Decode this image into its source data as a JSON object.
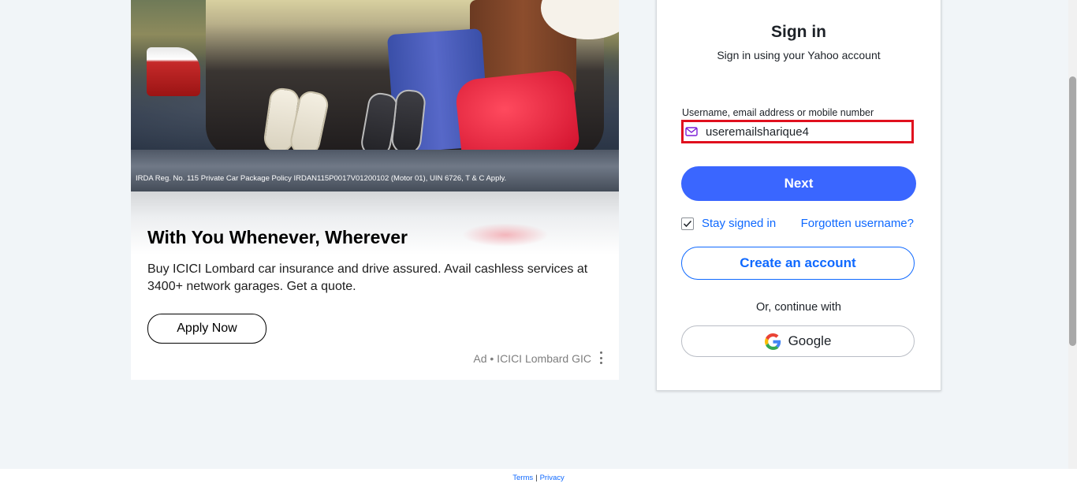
{
  "ad": {
    "disclaimer": "IRDA Reg. No. 115  Private Car Package Policy IRDAN115P0017V01200102 (Motor 01), UIN 6726, T & C Apply.",
    "headline": "With You Whenever, Wherever",
    "body": "Buy ICICI Lombard car insurance and drive assured. Avail cashless services at 3400+ network garages. Get a quote.",
    "cta_label": "Apply Now",
    "source": "Ad • ICICI Lombard GIC",
    "menu_icon": "kebab-icon"
  },
  "signin": {
    "title": "Sign in",
    "subtitle": "Sign in using your Yahoo account",
    "username_label": "Username, email address or mobile number",
    "username_value": "useremailsharique4",
    "field_icon": "mail-icon",
    "next_label": "Next",
    "stay_signed_in_label": "Stay signed in",
    "stay_signed_in_checked": true,
    "forgot_label": "Forgotten username?",
    "create_account_label": "Create an account",
    "or_text": "Or, continue with",
    "google_label": "Google",
    "google_icon": "google-icon"
  },
  "footer": {
    "terms_label": "Terms",
    "separator": "|",
    "privacy_label": "Privacy"
  },
  "colors": {
    "accent": "#3a66ff",
    "link": "#0f69ff",
    "error_border": "#e0101e",
    "page_bg": "#f1f5f8"
  }
}
